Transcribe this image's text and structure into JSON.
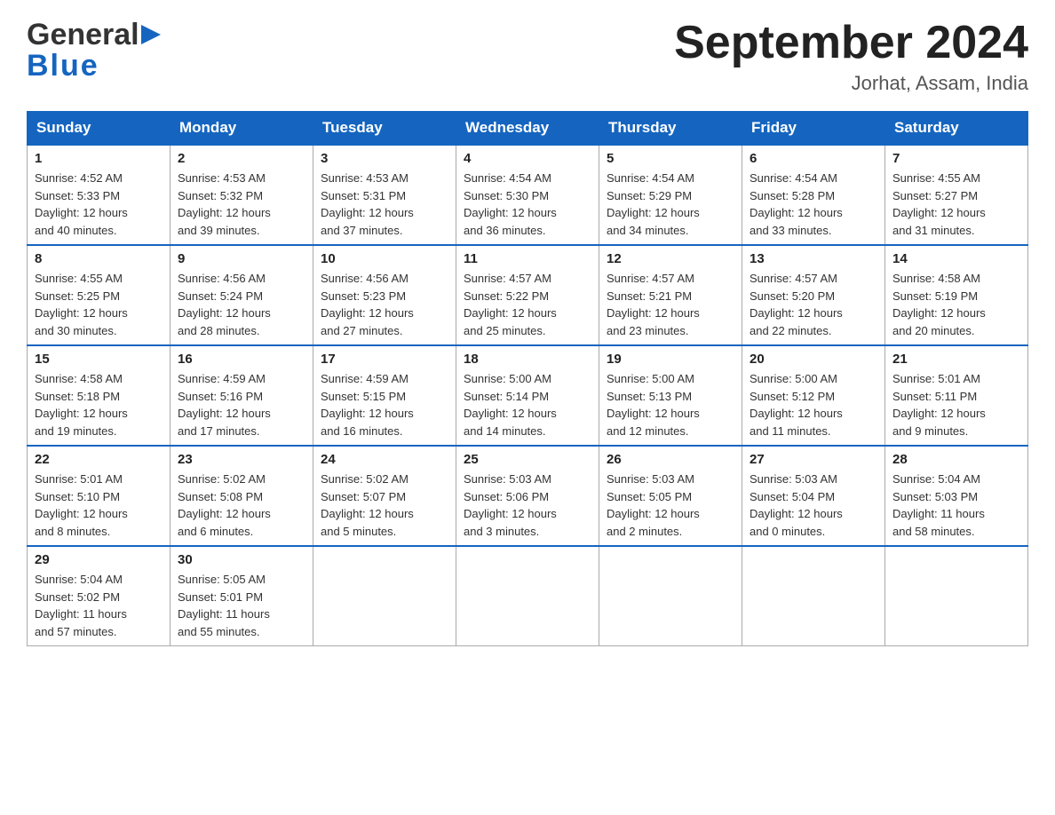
{
  "header": {
    "logo": {
      "line1": "General",
      "triangle": "▶",
      "line2": "Blue"
    },
    "title": "September 2024",
    "location": "Jorhat, Assam, India"
  },
  "weekdays": [
    "Sunday",
    "Monday",
    "Tuesday",
    "Wednesday",
    "Thursday",
    "Friday",
    "Saturday"
  ],
  "weeks": [
    [
      {
        "day": "1",
        "sunrise": "4:52 AM",
        "sunset": "5:33 PM",
        "daylight": "12 hours and 40 minutes."
      },
      {
        "day": "2",
        "sunrise": "4:53 AM",
        "sunset": "5:32 PM",
        "daylight": "12 hours and 39 minutes."
      },
      {
        "day": "3",
        "sunrise": "4:53 AM",
        "sunset": "5:31 PM",
        "daylight": "12 hours and 37 minutes."
      },
      {
        "day": "4",
        "sunrise": "4:54 AM",
        "sunset": "5:30 PM",
        "daylight": "12 hours and 36 minutes."
      },
      {
        "day": "5",
        "sunrise": "4:54 AM",
        "sunset": "5:29 PM",
        "daylight": "12 hours and 34 minutes."
      },
      {
        "day": "6",
        "sunrise": "4:54 AM",
        "sunset": "5:28 PM",
        "daylight": "12 hours and 33 minutes."
      },
      {
        "day": "7",
        "sunrise": "4:55 AM",
        "sunset": "5:27 PM",
        "daylight": "12 hours and 31 minutes."
      }
    ],
    [
      {
        "day": "8",
        "sunrise": "4:55 AM",
        "sunset": "5:25 PM",
        "daylight": "12 hours and 30 minutes."
      },
      {
        "day": "9",
        "sunrise": "4:56 AM",
        "sunset": "5:24 PM",
        "daylight": "12 hours and 28 minutes."
      },
      {
        "day": "10",
        "sunrise": "4:56 AM",
        "sunset": "5:23 PM",
        "daylight": "12 hours and 27 minutes."
      },
      {
        "day": "11",
        "sunrise": "4:57 AM",
        "sunset": "5:22 PM",
        "daylight": "12 hours and 25 minutes."
      },
      {
        "day": "12",
        "sunrise": "4:57 AM",
        "sunset": "5:21 PM",
        "daylight": "12 hours and 23 minutes."
      },
      {
        "day": "13",
        "sunrise": "4:57 AM",
        "sunset": "5:20 PM",
        "daylight": "12 hours and 22 minutes."
      },
      {
        "day": "14",
        "sunrise": "4:58 AM",
        "sunset": "5:19 PM",
        "daylight": "12 hours and 20 minutes."
      }
    ],
    [
      {
        "day": "15",
        "sunrise": "4:58 AM",
        "sunset": "5:18 PM",
        "daylight": "12 hours and 19 minutes."
      },
      {
        "day": "16",
        "sunrise": "4:59 AM",
        "sunset": "5:16 PM",
        "daylight": "12 hours and 17 minutes."
      },
      {
        "day": "17",
        "sunrise": "4:59 AM",
        "sunset": "5:15 PM",
        "daylight": "12 hours and 16 minutes."
      },
      {
        "day": "18",
        "sunrise": "5:00 AM",
        "sunset": "5:14 PM",
        "daylight": "12 hours and 14 minutes."
      },
      {
        "day": "19",
        "sunrise": "5:00 AM",
        "sunset": "5:13 PM",
        "daylight": "12 hours and 12 minutes."
      },
      {
        "day": "20",
        "sunrise": "5:00 AM",
        "sunset": "5:12 PM",
        "daylight": "12 hours and 11 minutes."
      },
      {
        "day": "21",
        "sunrise": "5:01 AM",
        "sunset": "5:11 PM",
        "daylight": "12 hours and 9 minutes."
      }
    ],
    [
      {
        "day": "22",
        "sunrise": "5:01 AM",
        "sunset": "5:10 PM",
        "daylight": "12 hours and 8 minutes."
      },
      {
        "day": "23",
        "sunrise": "5:02 AM",
        "sunset": "5:08 PM",
        "daylight": "12 hours and 6 minutes."
      },
      {
        "day": "24",
        "sunrise": "5:02 AM",
        "sunset": "5:07 PM",
        "daylight": "12 hours and 5 minutes."
      },
      {
        "day": "25",
        "sunrise": "5:03 AM",
        "sunset": "5:06 PM",
        "daylight": "12 hours and 3 minutes."
      },
      {
        "day": "26",
        "sunrise": "5:03 AM",
        "sunset": "5:05 PM",
        "daylight": "12 hours and 2 minutes."
      },
      {
        "day": "27",
        "sunrise": "5:03 AM",
        "sunset": "5:04 PM",
        "daylight": "12 hours and 0 minutes."
      },
      {
        "day": "28",
        "sunrise": "5:04 AM",
        "sunset": "5:03 PM",
        "daylight": "11 hours and 58 minutes."
      }
    ],
    [
      {
        "day": "29",
        "sunrise": "5:04 AM",
        "sunset": "5:02 PM",
        "daylight": "11 hours and 57 minutes."
      },
      {
        "day": "30",
        "sunrise": "5:05 AM",
        "sunset": "5:01 PM",
        "daylight": "11 hours and 55 minutes."
      },
      null,
      null,
      null,
      null,
      null
    ]
  ],
  "labels": {
    "sunrise": "Sunrise:",
    "sunset": "Sunset:",
    "daylight": "Daylight:"
  }
}
